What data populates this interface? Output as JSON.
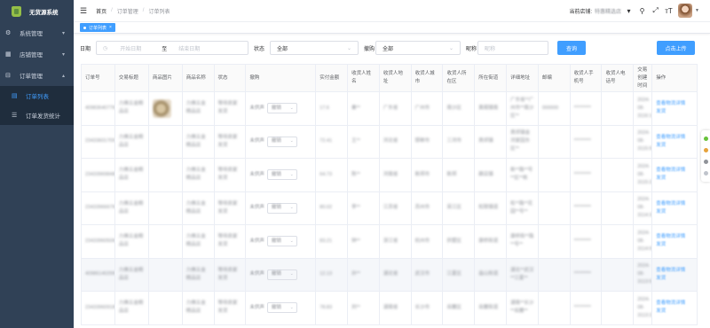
{
  "app": {
    "title": "无货源系统"
  },
  "sidebar": {
    "items": [
      {
        "label": "系统管理",
        "icon": "gear-icon"
      },
      {
        "label": "店铺管理",
        "icon": "grid-icon"
      },
      {
        "label": "订单管理",
        "icon": "cart-icon"
      }
    ],
    "subitems": [
      {
        "label": "订单列表",
        "icon": "document-icon"
      },
      {
        "label": "订单发货统计",
        "icon": "list-icon"
      }
    ]
  },
  "header": {
    "breadcrumb": [
      "首页",
      "订单管理",
      "订单列表"
    ],
    "store_label": "当前店铺:",
    "store_name": "特惠精选店"
  },
  "tags": {
    "active": "订单列表"
  },
  "filters": {
    "date_label": "日期",
    "start_placeholder": "开始日期",
    "to": "至",
    "end_placeholder": "结束日期",
    "status_label": "状态",
    "status_value": "全部",
    "purchase_label": "撤购",
    "purchase_value": "全部",
    "nickname_label": "昵称",
    "nickname_placeholder": "昵称",
    "search_button": "查询",
    "upload_button": "点击上传"
  },
  "table": {
    "columns": [
      "订单号",
      "交易标题",
      "商品图片",
      "商品名称",
      "状态",
      "撤购",
      "实付金额",
      "收货人姓名",
      "收货人地址",
      "收货人城市",
      "收货人所在区",
      "所在街道",
      "详细地址",
      "邮编",
      "收货人手机号",
      "收货人电话号",
      "交易创建时间",
      "操作"
    ],
    "select_value": "撤销",
    "rows": [
      {
        "order_no": "4098364077666002204",
        "title": "力佛五金精品店",
        "has_image": true,
        "product": "力佛五金精品店",
        "status": "等待卖家发货",
        "purchase": "未供声",
        "amount": "17.6",
        "name": "秦**",
        "address": "广东省",
        "city": "广州市",
        "district": "南沙区",
        "street": "黄阁镇南",
        "detail": "广东省**广州市**南沙区**",
        "zip": "000000",
        "phone": "*********",
        "tel": "",
        "created": "2024-08-3116:14:45",
        "ops": [
          "查看物流详情",
          "发货"
        ]
      },
      {
        "order_no": "2343360170971039005",
        "title": "力佛五金精品店",
        "has_image": false,
        "product": "力佛五金精品店",
        "status": "等待卖家发货",
        "purchase": "未供声",
        "amount": "72.41",
        "name": "王**",
        "address": "河北省",
        "city": "邯郸市",
        "district": "三河市",
        "street": "燕郊镇",
        "detail": "燕郊镇金河家园东区**",
        "zip": "",
        "phone": "*********",
        "tel": "",
        "created": "2024-08-3115:58:40",
        "ops": [
          "查看物流详情",
          "发货"
        ]
      },
      {
        "order_no": "2343396984884016099",
        "title": "力佛五金精品店",
        "has_image": false,
        "product": "力佛五金精品店",
        "status": "等待卖家发货",
        "purchase": "未供声",
        "amount": "64.73",
        "name": "陈**",
        "address": "河南省",
        "city": "新郑市",
        "district": "新郑",
        "street": "薛店镇",
        "detail": "新**路**号**区**栋",
        "zip": "",
        "phone": "*********",
        "tel": "",
        "created": "2024-08-3115:23:04",
        "ops": [
          "查看物流详情",
          "发货"
        ]
      },
      {
        "order_no": "2343396667602995006",
        "title": "力佛五金精品店",
        "has_image": false,
        "product": "力佛五金精品店",
        "status": "等待卖家发货",
        "purchase": "未供声",
        "amount": "80.02",
        "name": "李**",
        "address": "江苏省",
        "city": "苏州市",
        "district": "吴江区",
        "street": "松陵镇道",
        "detail": "松**路**花园**号**",
        "zip": "",
        "phone": "*********",
        "tel": "",
        "created": "2024-08-3114:32:31",
        "ops": [
          "查看物流详情",
          "发货"
        ]
      },
      {
        "order_no": "2343396050608306773",
        "title": "力佛五金精品店",
        "has_image": false,
        "product": "力佛五金精品店",
        "status": "等待卖家发货",
        "purchase": "未供声",
        "amount": "83.21",
        "name": "钟**",
        "address": "浙江省",
        "city": "杭州市",
        "district": "拱墅区",
        "street": "康桥街道",
        "detail": "康桥街**路**号**",
        "zip": "",
        "phone": "*********",
        "tel": "",
        "created": "2024-08-3114:08:07",
        "ops": [
          "查看物流详情",
          "发货"
        ]
      },
      {
        "order_no": "4098614029969171690",
        "title": "力佛五金精品店",
        "has_image": false,
        "product": "力佛五金精品店",
        "status": "等待卖家发货",
        "purchase": "未供声",
        "amount": "12.13",
        "name": "孙**",
        "address": "湖北省",
        "city": "武汉市",
        "district": "江夏区",
        "street": "庙山街道",
        "detail": "湖北**武汉**江夏**",
        "zip": "",
        "phone": "*********",
        "tel": "",
        "created": "2024-08-3113:51:16",
        "ops": [
          "查看物流详情",
          "发货"
        ]
      },
      {
        "order_no": "2343396091867980",
        "title": "力佛五金精品店",
        "has_image": false,
        "product": "力佛五金精品店",
        "status": "等待卖家发货",
        "purchase": "未供声",
        "amount": "78.83",
        "name": "刘**",
        "address": "湖南省",
        "city": "长沙市",
        "district": "岳麓区",
        "street": "岳麓街道",
        "detail": "湖南**长沙**岳麓**",
        "zip": "",
        "phone": "*********",
        "tel": "",
        "created": "2024-08-3113:22:09",
        "ops": [
          "查看物流详情",
          "发货"
        ]
      }
    ]
  },
  "colors": {
    "sidebar_bg": "#304156",
    "primary": "#409eff"
  }
}
